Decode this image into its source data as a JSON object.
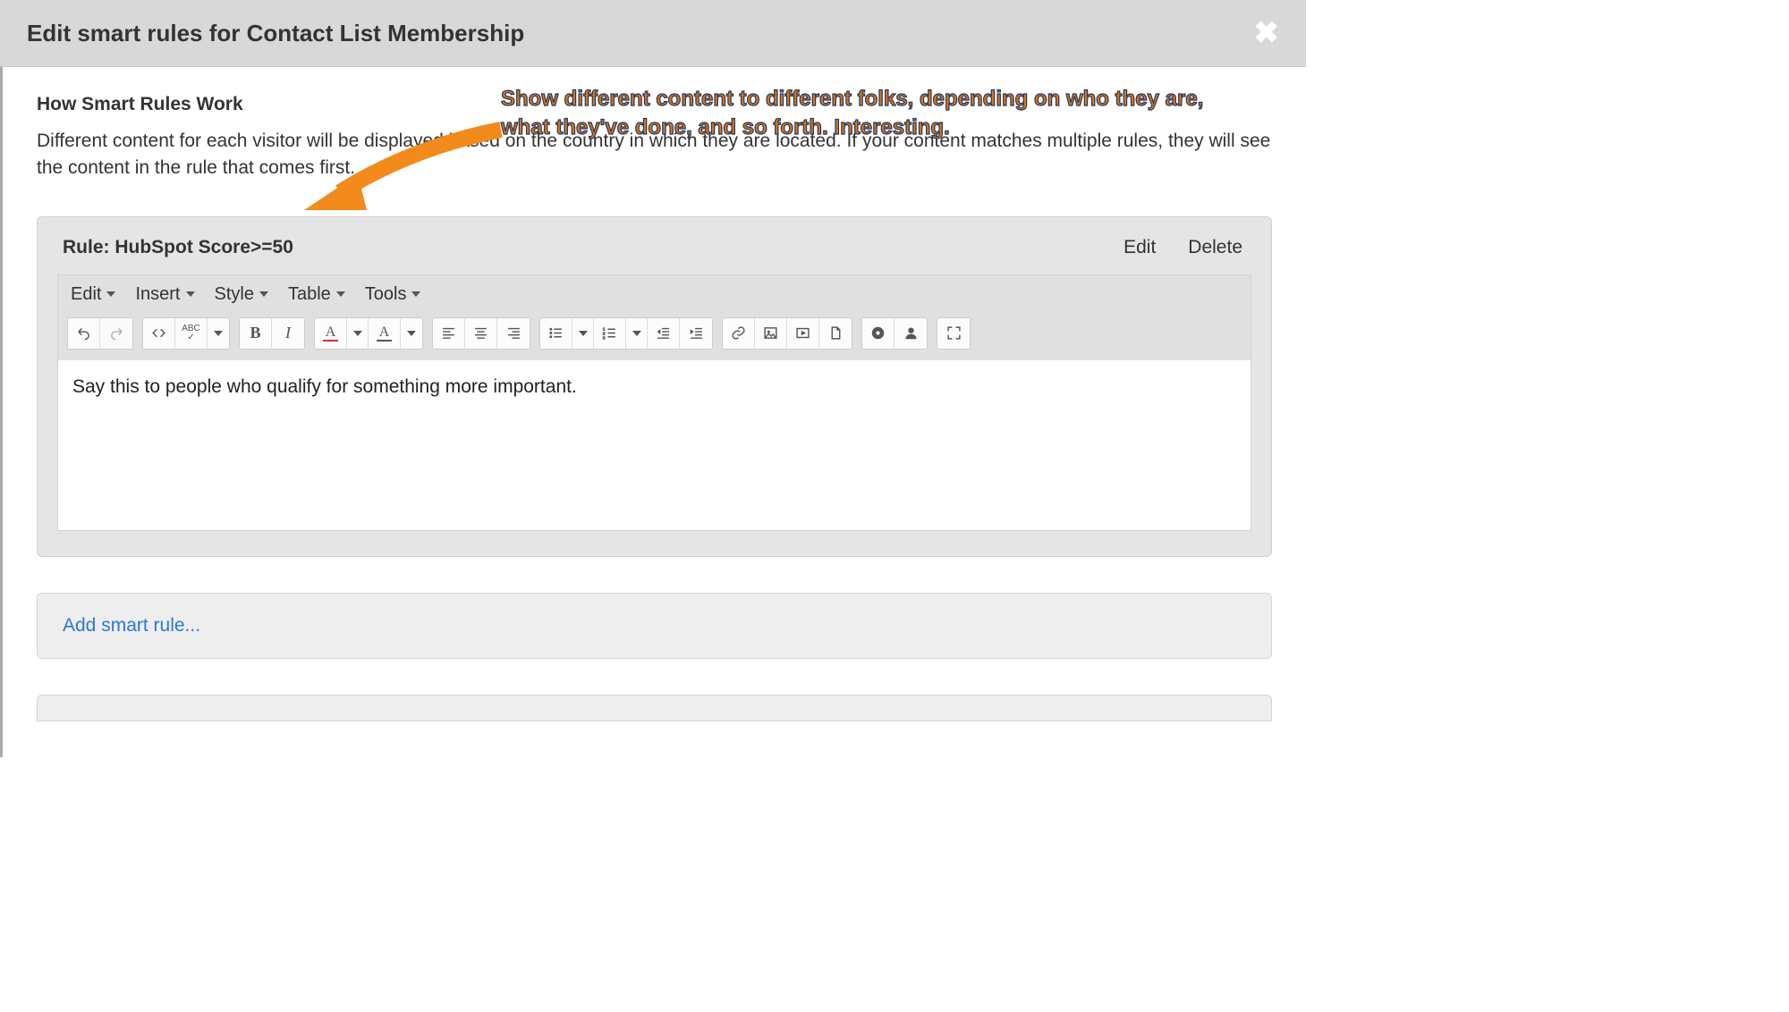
{
  "modal": {
    "title": "Edit smart rules for Contact List Membership"
  },
  "howworks": {
    "heading": "How Smart Rules Work",
    "description": "Different content for each visitor will be displayed based on the country in which they are located. If your content matches multiple rules, they will see the content in the rule that comes first."
  },
  "rule": {
    "title": "Rule: HubSpot Score>=50",
    "edit_label": "Edit",
    "delete_label": "Delete"
  },
  "editor": {
    "menubar": {
      "edit": "Edit",
      "insert": "Insert",
      "style": "Style",
      "table": "Table",
      "tools": "Tools"
    },
    "content": "Say this to people who qualify for something more important."
  },
  "add": {
    "label": "Add smart rule..."
  },
  "annotation": {
    "text": "Show different content to different folks, depending on who they are, what they've done, and so forth. Interesting."
  },
  "icons": {
    "close": "close-icon",
    "undo": "undo-icon",
    "redo": "redo-icon",
    "code": "source-code-icon",
    "spellcheck": "spellcheck-icon",
    "bold": "bold-icon",
    "italic": "italic-icon",
    "textcolor": "text-color-icon",
    "bgcolor": "background-color-icon",
    "alignleft": "align-left-icon",
    "aligncenter": "align-center-icon",
    "alignright": "align-right-icon",
    "ul": "bullet-list-icon",
    "ol": "numbered-list-icon",
    "outdent": "outdent-icon",
    "indent": "indent-icon",
    "link": "link-icon",
    "image": "image-icon",
    "video": "video-icon",
    "file": "file-icon",
    "gear": "gear-icon",
    "user": "user-icon",
    "fullscreen": "fullscreen-icon"
  }
}
